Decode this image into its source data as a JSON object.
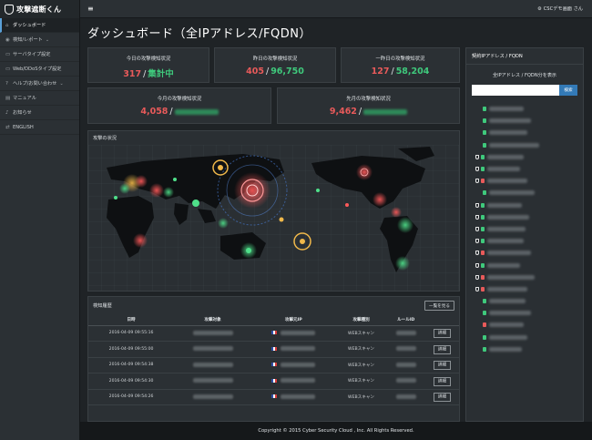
{
  "app": {
    "logo": "攻撃遮断くん",
    "user": "CSCデモ画面 さん"
  },
  "sidebar": {
    "items": [
      {
        "label": "ダッシュボード",
        "icon": "home-icon",
        "active": true,
        "chev": ""
      },
      {
        "label": "検知/レポート",
        "icon": "eye-icon",
        "active": false,
        "chev": "⌄"
      },
      {
        "label": "サーバタイプ設定",
        "icon": "server-icon",
        "active": false,
        "chev": ""
      },
      {
        "label": "Web/DDoSタイプ設定",
        "icon": "server-icon",
        "active": false,
        "chev": ""
      },
      {
        "label": "ヘルプ/お問い合わせ",
        "icon": "question-icon",
        "active": false,
        "chev": "⌄"
      },
      {
        "label": "マニュアル",
        "icon": "book-icon",
        "active": false,
        "chev": ""
      },
      {
        "label": "お知らせ",
        "icon": "bell-icon",
        "active": false,
        "chev": ""
      },
      {
        "label": "ENGLISH",
        "icon": "swap-icon",
        "active": false,
        "chev": ""
      }
    ]
  },
  "page": {
    "title": "ダッシュボード（全IPアドレス/FQDN）"
  },
  "stats": {
    "today": {
      "label": "今日の攻撃検知状況",
      "count": "317",
      "status": "集計中"
    },
    "yesterday": {
      "label": "昨日の攻撃検知状況",
      "count": "405",
      "total": "96,750"
    },
    "day_before": {
      "label": "一昨日の攻撃検知状況",
      "count": "127",
      "total": "58,204"
    },
    "this_month": {
      "label": "今月の攻撃検知状況",
      "count": "4,058"
    },
    "last_month": {
      "label": "先月の攻撃検知状況",
      "count": "9,462"
    }
  },
  "map": {
    "title": "攻撃の状況"
  },
  "history": {
    "title": "検知履歴",
    "view_all": "一覧を見る",
    "columns": [
      "日時",
      "攻撃対象",
      "攻撃元IP",
      "攻撃種別",
      "ルールID",
      ""
    ],
    "rows": [
      {
        "time": "2016-04-09 09:55:16",
        "type": "WEBスキャン",
        "action": "詳細"
      },
      {
        "time": "2016-04-09 09:55:00",
        "type": "WEBスキャン",
        "action": "詳細"
      },
      {
        "time": "2016-04-09 09:54:38",
        "type": "WEBスキャン",
        "action": "詳細"
      },
      {
        "time": "2016-04-09 09:54:30",
        "type": "WEBスキャン",
        "action": "詳細"
      },
      {
        "time": "2016-04-09 09:54:26",
        "type": "WEBスキャン",
        "action": "詳細"
      }
    ]
  },
  "contract": {
    "title": "契約IPアドレス / FQDN",
    "subtitle": "全IPアドレス / FQDN分を表示",
    "search_placeholder": "",
    "search_button": "検索"
  },
  "footer": {
    "text": "Copyright © 2015 Cyber Security Cloud , Inc. All Rights Reserved."
  },
  "colors": {
    "accent": "#337ab7",
    "red": "#e85a5a",
    "green": "#3fc97c"
  }
}
